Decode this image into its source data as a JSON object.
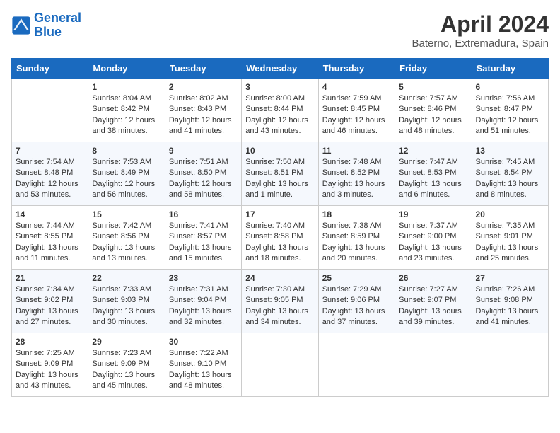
{
  "header": {
    "logo_line1": "General",
    "logo_line2": "Blue",
    "month": "April 2024",
    "location": "Baterno, Extremadura, Spain"
  },
  "days_of_week": [
    "Sunday",
    "Monday",
    "Tuesday",
    "Wednesday",
    "Thursday",
    "Friday",
    "Saturday"
  ],
  "weeks": [
    [
      {
        "day": "",
        "sunrise": "",
        "sunset": "",
        "daylight": ""
      },
      {
        "day": "1",
        "sunrise": "Sunrise: 8:04 AM",
        "sunset": "Sunset: 8:42 PM",
        "daylight": "Daylight: 12 hours and 38 minutes."
      },
      {
        "day": "2",
        "sunrise": "Sunrise: 8:02 AM",
        "sunset": "Sunset: 8:43 PM",
        "daylight": "Daylight: 12 hours and 41 minutes."
      },
      {
        "day": "3",
        "sunrise": "Sunrise: 8:00 AM",
        "sunset": "Sunset: 8:44 PM",
        "daylight": "Daylight: 12 hours and 43 minutes."
      },
      {
        "day": "4",
        "sunrise": "Sunrise: 7:59 AM",
        "sunset": "Sunset: 8:45 PM",
        "daylight": "Daylight: 12 hours and 46 minutes."
      },
      {
        "day": "5",
        "sunrise": "Sunrise: 7:57 AM",
        "sunset": "Sunset: 8:46 PM",
        "daylight": "Daylight: 12 hours and 48 minutes."
      },
      {
        "day": "6",
        "sunrise": "Sunrise: 7:56 AM",
        "sunset": "Sunset: 8:47 PM",
        "daylight": "Daylight: 12 hours and 51 minutes."
      }
    ],
    [
      {
        "day": "7",
        "sunrise": "Sunrise: 7:54 AM",
        "sunset": "Sunset: 8:48 PM",
        "daylight": "Daylight: 12 hours and 53 minutes."
      },
      {
        "day": "8",
        "sunrise": "Sunrise: 7:53 AM",
        "sunset": "Sunset: 8:49 PM",
        "daylight": "Daylight: 12 hours and 56 minutes."
      },
      {
        "day": "9",
        "sunrise": "Sunrise: 7:51 AM",
        "sunset": "Sunset: 8:50 PM",
        "daylight": "Daylight: 12 hours and 58 minutes."
      },
      {
        "day": "10",
        "sunrise": "Sunrise: 7:50 AM",
        "sunset": "Sunset: 8:51 PM",
        "daylight": "Daylight: 13 hours and 1 minute."
      },
      {
        "day": "11",
        "sunrise": "Sunrise: 7:48 AM",
        "sunset": "Sunset: 8:52 PM",
        "daylight": "Daylight: 13 hours and 3 minutes."
      },
      {
        "day": "12",
        "sunrise": "Sunrise: 7:47 AM",
        "sunset": "Sunset: 8:53 PM",
        "daylight": "Daylight: 13 hours and 6 minutes."
      },
      {
        "day": "13",
        "sunrise": "Sunrise: 7:45 AM",
        "sunset": "Sunset: 8:54 PM",
        "daylight": "Daylight: 13 hours and 8 minutes."
      }
    ],
    [
      {
        "day": "14",
        "sunrise": "Sunrise: 7:44 AM",
        "sunset": "Sunset: 8:55 PM",
        "daylight": "Daylight: 13 hours and 11 minutes."
      },
      {
        "day": "15",
        "sunrise": "Sunrise: 7:42 AM",
        "sunset": "Sunset: 8:56 PM",
        "daylight": "Daylight: 13 hours and 13 minutes."
      },
      {
        "day": "16",
        "sunrise": "Sunrise: 7:41 AM",
        "sunset": "Sunset: 8:57 PM",
        "daylight": "Daylight: 13 hours and 15 minutes."
      },
      {
        "day": "17",
        "sunrise": "Sunrise: 7:40 AM",
        "sunset": "Sunset: 8:58 PM",
        "daylight": "Daylight: 13 hours and 18 minutes."
      },
      {
        "day": "18",
        "sunrise": "Sunrise: 7:38 AM",
        "sunset": "Sunset: 8:59 PM",
        "daylight": "Daylight: 13 hours and 20 minutes."
      },
      {
        "day": "19",
        "sunrise": "Sunrise: 7:37 AM",
        "sunset": "Sunset: 9:00 PM",
        "daylight": "Daylight: 13 hours and 23 minutes."
      },
      {
        "day": "20",
        "sunrise": "Sunrise: 7:35 AM",
        "sunset": "Sunset: 9:01 PM",
        "daylight": "Daylight: 13 hours and 25 minutes."
      }
    ],
    [
      {
        "day": "21",
        "sunrise": "Sunrise: 7:34 AM",
        "sunset": "Sunset: 9:02 PM",
        "daylight": "Daylight: 13 hours and 27 minutes."
      },
      {
        "day": "22",
        "sunrise": "Sunrise: 7:33 AM",
        "sunset": "Sunset: 9:03 PM",
        "daylight": "Daylight: 13 hours and 30 minutes."
      },
      {
        "day": "23",
        "sunrise": "Sunrise: 7:31 AM",
        "sunset": "Sunset: 9:04 PM",
        "daylight": "Daylight: 13 hours and 32 minutes."
      },
      {
        "day": "24",
        "sunrise": "Sunrise: 7:30 AM",
        "sunset": "Sunset: 9:05 PM",
        "daylight": "Daylight: 13 hours and 34 minutes."
      },
      {
        "day": "25",
        "sunrise": "Sunrise: 7:29 AM",
        "sunset": "Sunset: 9:06 PM",
        "daylight": "Daylight: 13 hours and 37 minutes."
      },
      {
        "day": "26",
        "sunrise": "Sunrise: 7:27 AM",
        "sunset": "Sunset: 9:07 PM",
        "daylight": "Daylight: 13 hours and 39 minutes."
      },
      {
        "day": "27",
        "sunrise": "Sunrise: 7:26 AM",
        "sunset": "Sunset: 9:08 PM",
        "daylight": "Daylight: 13 hours and 41 minutes."
      }
    ],
    [
      {
        "day": "28",
        "sunrise": "Sunrise: 7:25 AM",
        "sunset": "Sunset: 9:09 PM",
        "daylight": "Daylight: 13 hours and 43 minutes."
      },
      {
        "day": "29",
        "sunrise": "Sunrise: 7:23 AM",
        "sunset": "Sunset: 9:09 PM",
        "daylight": "Daylight: 13 hours and 45 minutes."
      },
      {
        "day": "30",
        "sunrise": "Sunrise: 7:22 AM",
        "sunset": "Sunset: 9:10 PM",
        "daylight": "Daylight: 13 hours and 48 minutes."
      },
      {
        "day": "",
        "sunrise": "",
        "sunset": "",
        "daylight": ""
      },
      {
        "day": "",
        "sunrise": "",
        "sunset": "",
        "daylight": ""
      },
      {
        "day": "",
        "sunrise": "",
        "sunset": "",
        "daylight": ""
      },
      {
        "day": "",
        "sunrise": "",
        "sunset": "",
        "daylight": ""
      }
    ]
  ]
}
